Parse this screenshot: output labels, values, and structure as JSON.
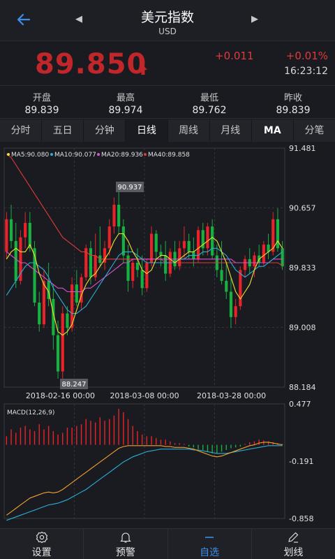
{
  "header": {
    "title": "美元指数",
    "subtitle": "USD",
    "prev_icon": "◀",
    "next_icon": "▶"
  },
  "quote": {
    "price": "89.850",
    "change": "+0.011",
    "change_pct": "+0.01%",
    "time": "16:23:12"
  },
  "stats": [
    {
      "label": "开盘",
      "value": "89.839"
    },
    {
      "label": "最高",
      "value": "89.974"
    },
    {
      "label": "最低",
      "value": "89.762"
    },
    {
      "label": "昨收",
      "value": "89.839"
    }
  ],
  "tabs": [
    {
      "label": "分时"
    },
    {
      "label": "五日"
    },
    {
      "label": "分钟"
    },
    {
      "label": "日线"
    },
    {
      "label": "周线"
    },
    {
      "label": "月线"
    },
    {
      "label": "MA"
    },
    {
      "label": "分笔"
    }
  ],
  "active_tab": "日线",
  "colors": {
    "up": "#e8242a",
    "down": "#18b040",
    "ma5": "#f0e030",
    "ma10": "#2ab0d8",
    "ma20": "#e050d0",
    "ma40": "#e03a3a",
    "dif": "#f0a030",
    "dea": "#2ab0d8",
    "accent": "#3d8ee8"
  },
  "chart_data": [
    {
      "type": "candlestick",
      "ma_legend": [
        {
          "name": "MA5",
          "value": "90.080"
        },
        {
          "name": "MA10",
          "value": "90.077"
        },
        {
          "name": "MA20",
          "value": "89.936"
        },
        {
          "name": "MA40",
          "value": "89.858"
        }
      ],
      "y_ticks": [
        "91.481",
        "90.657",
        "89.833",
        "89.008",
        "88.184"
      ],
      "ylim": [
        88.184,
        91.481
      ],
      "x_labels": [
        "2018-02-16 00:00",
        "2018-03-08 00:00",
        "2018-03-28 00:00"
      ],
      "max_label": "90.937",
      "min_label": "88.247",
      "candles": [
        [
          90.05,
          90.6,
          89.95,
          90.5
        ],
        [
          90.5,
          90.7,
          90.1,
          90.2
        ],
        [
          90.2,
          90.45,
          89.55,
          89.65
        ],
        [
          89.65,
          90.35,
          89.6,
          90.25
        ],
        [
          90.25,
          90.6,
          90.1,
          90.45
        ],
        [
          90.45,
          90.6,
          90.05,
          90.1
        ],
        [
          90.1,
          90.2,
          89.3,
          89.35
        ],
        [
          89.35,
          89.5,
          88.95,
          89.05
        ],
        [
          89.05,
          89.8,
          89.0,
          89.65
        ],
        [
          89.65,
          89.9,
          89.3,
          89.4
        ],
        [
          89.4,
          89.6,
          88.7,
          88.9
        ],
        [
          88.9,
          89.1,
          88.3,
          88.4
        ],
        [
          88.4,
          89.3,
          88.25,
          89.2
        ],
        [
          89.2,
          89.3,
          88.9,
          89.0
        ],
        [
          89.0,
          89.7,
          88.95,
          89.6
        ],
        [
          89.6,
          89.8,
          89.3,
          89.35
        ],
        [
          89.35,
          89.75,
          89.25,
          89.7
        ],
        [
          89.7,
          90.15,
          89.65,
          90.1
        ],
        [
          90.1,
          90.2,
          89.6,
          89.7
        ],
        [
          89.7,
          90.3,
          89.65,
          90.0
        ],
        [
          90.0,
          90.4,
          89.85,
          89.9
        ],
        [
          89.9,
          90.2,
          89.8,
          90.1
        ],
        [
          90.1,
          90.5,
          90.0,
          90.4
        ],
        [
          90.4,
          90.8,
          90.3,
          90.7
        ],
        [
          90.7,
          90.94,
          90.3,
          90.4
        ],
        [
          90.4,
          90.5,
          89.9,
          90.0
        ],
        [
          90.0,
          90.15,
          89.5,
          89.65
        ],
        [
          89.65,
          89.95,
          89.55,
          89.9
        ],
        [
          89.9,
          90.1,
          89.7,
          89.8
        ],
        [
          89.8,
          90.0,
          89.45,
          89.55
        ],
        [
          89.55,
          89.95,
          89.5,
          89.9
        ],
        [
          89.9,
          90.4,
          89.85,
          90.3
        ],
        [
          90.3,
          90.35,
          89.95,
          90.05
        ],
        [
          90.05,
          90.15,
          89.85,
          90.0
        ],
        [
          90.0,
          90.2,
          89.65,
          89.75
        ],
        [
          89.75,
          90.1,
          89.7,
          90.05
        ],
        [
          90.05,
          90.2,
          89.8,
          89.85
        ],
        [
          89.85,
          90.2,
          89.8,
          90.1
        ],
        [
          90.1,
          90.4,
          89.95,
          90.2
        ],
        [
          90.2,
          90.3,
          89.95,
          90.05
        ],
        [
          90.05,
          90.25,
          89.85,
          89.95
        ],
        [
          89.95,
          90.4,
          89.9,
          90.35
        ],
        [
          90.35,
          90.45,
          90.0,
          90.1
        ],
        [
          90.1,
          90.45,
          90.0,
          90.4
        ],
        [
          90.4,
          90.5,
          89.95,
          90.0
        ],
        [
          90.0,
          90.15,
          89.7,
          89.8
        ],
        [
          89.8,
          90.2,
          89.6,
          89.65
        ],
        [
          89.65,
          89.9,
          89.4,
          89.5
        ],
        [
          89.5,
          89.7,
          89.0,
          89.15
        ],
        [
          89.15,
          89.4,
          89.05,
          89.3
        ],
        [
          89.3,
          89.85,
          89.25,
          89.8
        ],
        [
          89.8,
          90.0,
          89.7,
          89.95
        ],
        [
          89.95,
          90.1,
          89.75,
          89.85
        ],
        [
          89.85,
          90.05,
          89.7,
          90.0
        ],
        [
          90.0,
          90.15,
          89.85,
          89.9
        ],
        [
          89.9,
          90.2,
          89.85,
          90.15
        ],
        [
          90.15,
          90.3,
          89.95,
          90.05
        ],
        [
          90.05,
          90.6,
          90.0,
          90.5
        ],
        [
          90.5,
          90.65,
          90.05,
          90.1
        ],
        [
          90.1,
          90.2,
          89.8,
          89.85
        ]
      ],
      "ma5": [
        89.95,
        90.05,
        90.1,
        90.05,
        90.05,
        90.15,
        90.0,
        89.75,
        89.6,
        89.5,
        89.2,
        88.95,
        88.9,
        88.95,
        89.05,
        89.25,
        89.45,
        89.6,
        89.7,
        89.75,
        89.85,
        89.95,
        90.05,
        90.2,
        90.3,
        90.3,
        90.2,
        90.05,
        89.95,
        89.8,
        89.75,
        89.8,
        89.95,
        90.0,
        90.0,
        89.95,
        89.9,
        89.95,
        90.0,
        90.05,
        90.05,
        90.1,
        90.15,
        90.2,
        90.25,
        90.2,
        90.05,
        89.9,
        89.7,
        89.5,
        89.4,
        89.5,
        89.6,
        89.8,
        89.95,
        90.0,
        90.05,
        90.1,
        90.2,
        90.1
      ],
      "ma10": [
        89.45,
        89.55,
        89.65,
        89.75,
        89.85,
        89.9,
        89.9,
        89.85,
        89.8,
        89.7,
        89.55,
        89.45,
        89.35,
        89.25,
        89.2,
        89.2,
        89.25,
        89.3,
        89.4,
        89.5,
        89.6,
        89.7,
        89.8,
        89.9,
        90.0,
        90.05,
        90.05,
        90.05,
        90.0,
        89.95,
        89.9,
        89.9,
        89.9,
        89.9,
        89.9,
        89.9,
        89.9,
        89.95,
        89.95,
        90.0,
        90.0,
        90.0,
        90.05,
        90.05,
        90.1,
        90.1,
        90.05,
        90.0,
        89.9,
        89.8,
        89.75,
        89.7,
        89.75,
        89.8,
        89.85,
        89.85,
        89.9,
        89.95,
        90.0,
        90.05
      ],
      "ma20": [
        90.05,
        90.0,
        89.95,
        89.9,
        89.9,
        89.85,
        89.8,
        89.75,
        89.7,
        89.65,
        89.6,
        89.55,
        89.55,
        89.5,
        89.5,
        89.5,
        89.5,
        89.55,
        89.55,
        89.6,
        89.65,
        89.7,
        89.75,
        89.8,
        89.85,
        89.9,
        89.9,
        89.95,
        89.95,
        89.95,
        89.95,
        89.95,
        89.95,
        89.95,
        89.95,
        89.95,
        89.95,
        89.95,
        89.95,
        89.95,
        89.95,
        89.95,
        89.95,
        89.95,
        89.95,
        89.95,
        89.95,
        89.95,
        89.95,
        89.9,
        89.9,
        89.9,
        89.9,
        89.9,
        89.9,
        89.9,
        89.9,
        89.95,
        89.95,
        89.95
      ],
      "ma40": [
        91.4,
        91.35,
        91.25,
        91.15,
        91.05,
        90.95,
        90.85,
        90.75,
        90.65,
        90.55,
        90.45,
        90.35,
        90.25,
        90.2,
        90.15,
        90.1,
        90.05,
        90.05,
        90.0,
        90.0,
        89.95,
        89.95,
        89.95,
        89.95,
        89.95,
        89.95,
        89.95,
        89.95,
        89.95,
        89.95,
        89.95,
        89.95,
        89.95,
        89.95,
        89.9,
        89.9,
        89.9,
        89.9,
        89.9,
        89.9,
        89.9,
        89.9,
        89.9,
        89.9,
        89.9,
        89.9,
        89.9,
        89.9,
        89.9,
        89.9,
        89.9,
        89.9,
        89.9,
        89.9,
        89.9,
        89.9,
        89.9,
        89.9,
        89.9,
        89.86
      ]
    },
    {
      "type": "macd",
      "title": "MACD(12,26,9)",
      "y_ticks": [
        "0.477",
        "-0.191",
        "-0.858"
      ],
      "ylim": [
        -0.858,
        0.477
      ],
      "hist": [
        0.1,
        0.18,
        0.14,
        0.2,
        0.22,
        0.18,
        0.16,
        0.24,
        0.18,
        0.22,
        0.16,
        0.12,
        0.14,
        0.2,
        0.2,
        0.22,
        0.24,
        0.3,
        0.28,
        0.26,
        0.32,
        0.28,
        0.3,
        0.34,
        0.42,
        0.38,
        0.3,
        0.22,
        0.16,
        0.12,
        0.1,
        0.1,
        0.08,
        0.06,
        0.06,
        0.04,
        0.02,
        0.02,
        0.01,
        -0.02,
        -0.03,
        -0.05,
        -0.06,
        -0.08,
        -0.1,
        -0.1,
        -0.08,
        -0.06,
        -0.04,
        -0.03,
        -0.02,
        0.01,
        0.03,
        0.04,
        0.06,
        0.05,
        0.04,
        0.03,
        0.02,
        0.01
      ],
      "dif": [
        -0.82,
        -0.78,
        -0.74,
        -0.7,
        -0.66,
        -0.62,
        -0.6,
        -0.58,
        -0.56,
        -0.55,
        -0.56,
        -0.55,
        -0.52,
        -0.48,
        -0.44,
        -0.4,
        -0.36,
        -0.32,
        -0.28,
        -0.24,
        -0.2,
        -0.16,
        -0.12,
        -0.08,
        -0.04,
        -0.02,
        -0.01,
        -0.01,
        -0.01,
        -0.01,
        -0.01,
        -0.01,
        -0.01,
        -0.01,
        -0.02,
        -0.02,
        -0.03,
        -0.03,
        -0.03,
        -0.04,
        -0.05,
        -0.07,
        -0.09,
        -0.11,
        -0.13,
        -0.14,
        -0.13,
        -0.11,
        -0.09,
        -0.07,
        -0.05,
        -0.03,
        -0.01,
        0.0,
        0.02,
        0.03,
        0.03,
        0.02,
        0.01,
        0.0
      ],
      "dea": [
        -0.88,
        -0.86,
        -0.84,
        -0.82,
        -0.8,
        -0.78,
        -0.76,
        -0.74,
        -0.72,
        -0.7,
        -0.69,
        -0.68,
        -0.66,
        -0.64,
        -0.61,
        -0.58,
        -0.55,
        -0.52,
        -0.48,
        -0.44,
        -0.4,
        -0.36,
        -0.32,
        -0.28,
        -0.24,
        -0.2,
        -0.17,
        -0.14,
        -0.12,
        -0.1,
        -0.08,
        -0.07,
        -0.06,
        -0.05,
        -0.05,
        -0.05,
        -0.05,
        -0.05,
        -0.05,
        -0.05,
        -0.06,
        -0.06,
        -0.07,
        -0.08,
        -0.09,
        -0.1,
        -0.1,
        -0.1,
        -0.09,
        -0.08,
        -0.07,
        -0.06,
        -0.05,
        -0.04,
        -0.03,
        -0.02,
        -0.01,
        -0.01,
        -0.01,
        -0.01
      ]
    }
  ],
  "bottom_nav": [
    {
      "label": "设置",
      "icon": "settings-icon"
    },
    {
      "label": "预警",
      "icon": "bell-icon"
    },
    {
      "label": "自选",
      "icon": "minus-icon"
    },
    {
      "label": "划线",
      "icon": "pen-icon"
    }
  ],
  "active_bottom": "自选"
}
